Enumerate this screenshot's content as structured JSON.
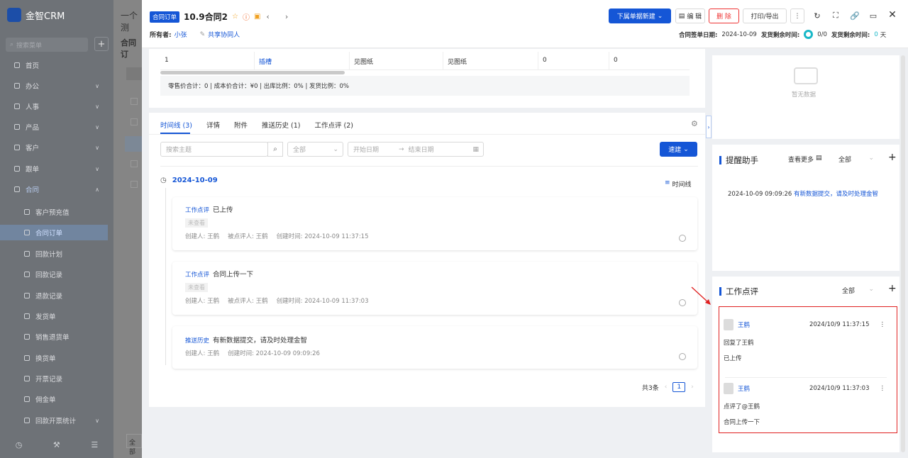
{
  "sidebar": {
    "app_name": "金智CRM",
    "search_placeholder": "搜索菜单",
    "menu": [
      {
        "label": "首页"
      },
      {
        "label": "办公"
      },
      {
        "label": "人事"
      },
      {
        "label": "产品"
      },
      {
        "label": "客户"
      },
      {
        "label": "跟单"
      },
      {
        "label": "合同"
      }
    ],
    "submenu": [
      {
        "label": "客户预充值"
      },
      {
        "label": "合同订单"
      },
      {
        "label": "回款计划"
      },
      {
        "label": "回款记录"
      },
      {
        "label": "退款记录"
      },
      {
        "label": "发货单"
      },
      {
        "label": "销售退货单"
      },
      {
        "label": "换货单"
      },
      {
        "label": "开票记录"
      },
      {
        "label": "佣金单"
      },
      {
        "label": "回款开票统计"
      }
    ]
  },
  "background": {
    "header_text": "一个测",
    "page_title": "合同订",
    "bottom_label": "全部"
  },
  "header": {
    "tag": "合同订单",
    "title": "10.9合同2",
    "owner_label": "所有者:",
    "owner": "小张",
    "share_label": "共享协同人",
    "create_sub": "下属单据新建",
    "edit": "编 辑",
    "delete": "删 除",
    "print": "打印/导出",
    "sign_date_label": "合同签单日期:",
    "sign_date": "2024-10-09",
    "ship_time_label": "发货剩余时间:",
    "progress": "0/0",
    "ship_time_label2": "发货剩余时间:",
    "days": "0",
    "days_unit": "天"
  },
  "product_table": {
    "row": [
      "1",
      "插槽",
      "见图纸",
      "见图纸",
      "0",
      "0"
    ],
    "summary": "零售价合计：0 |   成本价合计：¥0 |   出库比例：0% |   发货比例：0%"
  },
  "tabs": [
    {
      "label": "时间线 (3)"
    },
    {
      "label": "详情"
    },
    {
      "label": "附件"
    },
    {
      "label": "推送历史 (1)"
    },
    {
      "label": "工作点评 (2)"
    }
  ],
  "filters": {
    "search_placeholder": "搜索主题",
    "all": "全部",
    "start_placeholder": "开始日期",
    "end_placeholder": "结束日期",
    "quick_create": "速建"
  },
  "timeline": {
    "date": "2024-10-09",
    "view_label": "时间线",
    "entries": [
      {
        "tag": "工作点评",
        "title": "已上传",
        "unread": "未查看",
        "creator": "创建人: 王鹤",
        "reviewee": "被点评人: 王鹤",
        "created": "创建时间: 2024-10-09 11:37:15"
      },
      {
        "tag": "工作点评",
        "title": "合同上传一下",
        "unread": "未查看",
        "creator": "创建人: 王鹤",
        "reviewee": "被点评人: 王鹤",
        "created": "创建时间: 2024-10-09 11:37:03"
      },
      {
        "tag": "推送历史",
        "title": "有新数据提交，请及时处理金智",
        "creator": "创建人: 王鹤",
        "created": "创建时间: 2024-10-09 09:09:26"
      }
    ],
    "total": "共3条",
    "page": "1"
  },
  "right": {
    "empty": "暂无数据",
    "reminder_title": "提醒助手",
    "see_more": "查看更多",
    "all": "全部",
    "reminder_time": "2024-10-09 09:09:26",
    "reminder_text": "有新数据提交，请及时处理金智",
    "review_title": "工作点评",
    "review_all": "全部",
    "reviews": [
      {
        "name": "王鹤",
        "time": "2024/10/9 11:37:15",
        "line1": "回复了王鹤",
        "line2": "已上传"
      },
      {
        "name": "王鹤",
        "time": "2024/10/9 11:37:03",
        "line1": "点评了@王鹤",
        "line2": "合同上传一下"
      }
    ]
  },
  "colors": {
    "accent": "#1556d6",
    "danger": "#e33333",
    "highlight_box": "#e02020"
  }
}
